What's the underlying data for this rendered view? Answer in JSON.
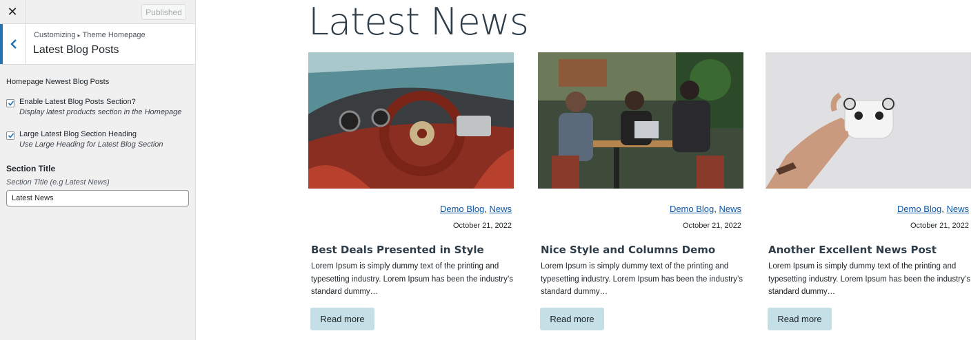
{
  "sidebar": {
    "close_icon": "✕",
    "published_label": "Published",
    "breadcrumb": {
      "root": "Customizing",
      "separator": "▸",
      "parent": "Theme Homepage"
    },
    "section_title": "Latest Blog Posts",
    "control_group_label": "Homepage Newest Blog Posts",
    "checkboxes": [
      {
        "label": "Enable Latest Blog Posts Section?",
        "description": "Display latest products section in the Homepage",
        "checked": true
      },
      {
        "label": "Large Latest Blog Section Heading",
        "description": "Use Large Heading for Latest Blog Section",
        "checked": true
      }
    ],
    "section_title_field": {
      "title": "Section Title",
      "description": "Section Title (e.g Latest News)",
      "value": "Latest News"
    }
  },
  "preview": {
    "heading": "Latest News",
    "posts": [
      {
        "image": "red-car-interior-photo",
        "categories": [
          "Demo Blog",
          "News"
        ],
        "date": "October 21, 2022",
        "title": "Best Deals Presented in Style",
        "excerpt": "Lorem Ipsum is simply dummy text of the printing and typesetting industry. Lorem Ipsum has been the industry’s standard dummy…",
        "read_more": "Read more"
      },
      {
        "image": "people-at-cafe-table-photo",
        "categories": [
          "Demo Blog",
          "News"
        ],
        "date": "October 21, 2022",
        "title": "Nice Style and Columns Demo",
        "excerpt": "Lorem Ipsum is simply dummy text of the printing and typesetting industry. Lorem Ipsum has been the industry’s standard dummy…",
        "read_more": "Read more"
      },
      {
        "image": "hand-holding-drone-photo",
        "categories": [
          "Demo Blog",
          "News"
        ],
        "date": "October 21, 2022",
        "title": "Another Excellent News Post",
        "excerpt": "Lorem Ipsum is simply dummy text of the printing and typesetting industry. Lorem Ipsum has been the industry’s standard dummy…",
        "read_more": "Read more"
      }
    ]
  },
  "colors": {
    "accent": "#2271b1",
    "link": "#0a58a8",
    "button_bg": "#c5dfe6",
    "heading": "#2f3d48"
  }
}
